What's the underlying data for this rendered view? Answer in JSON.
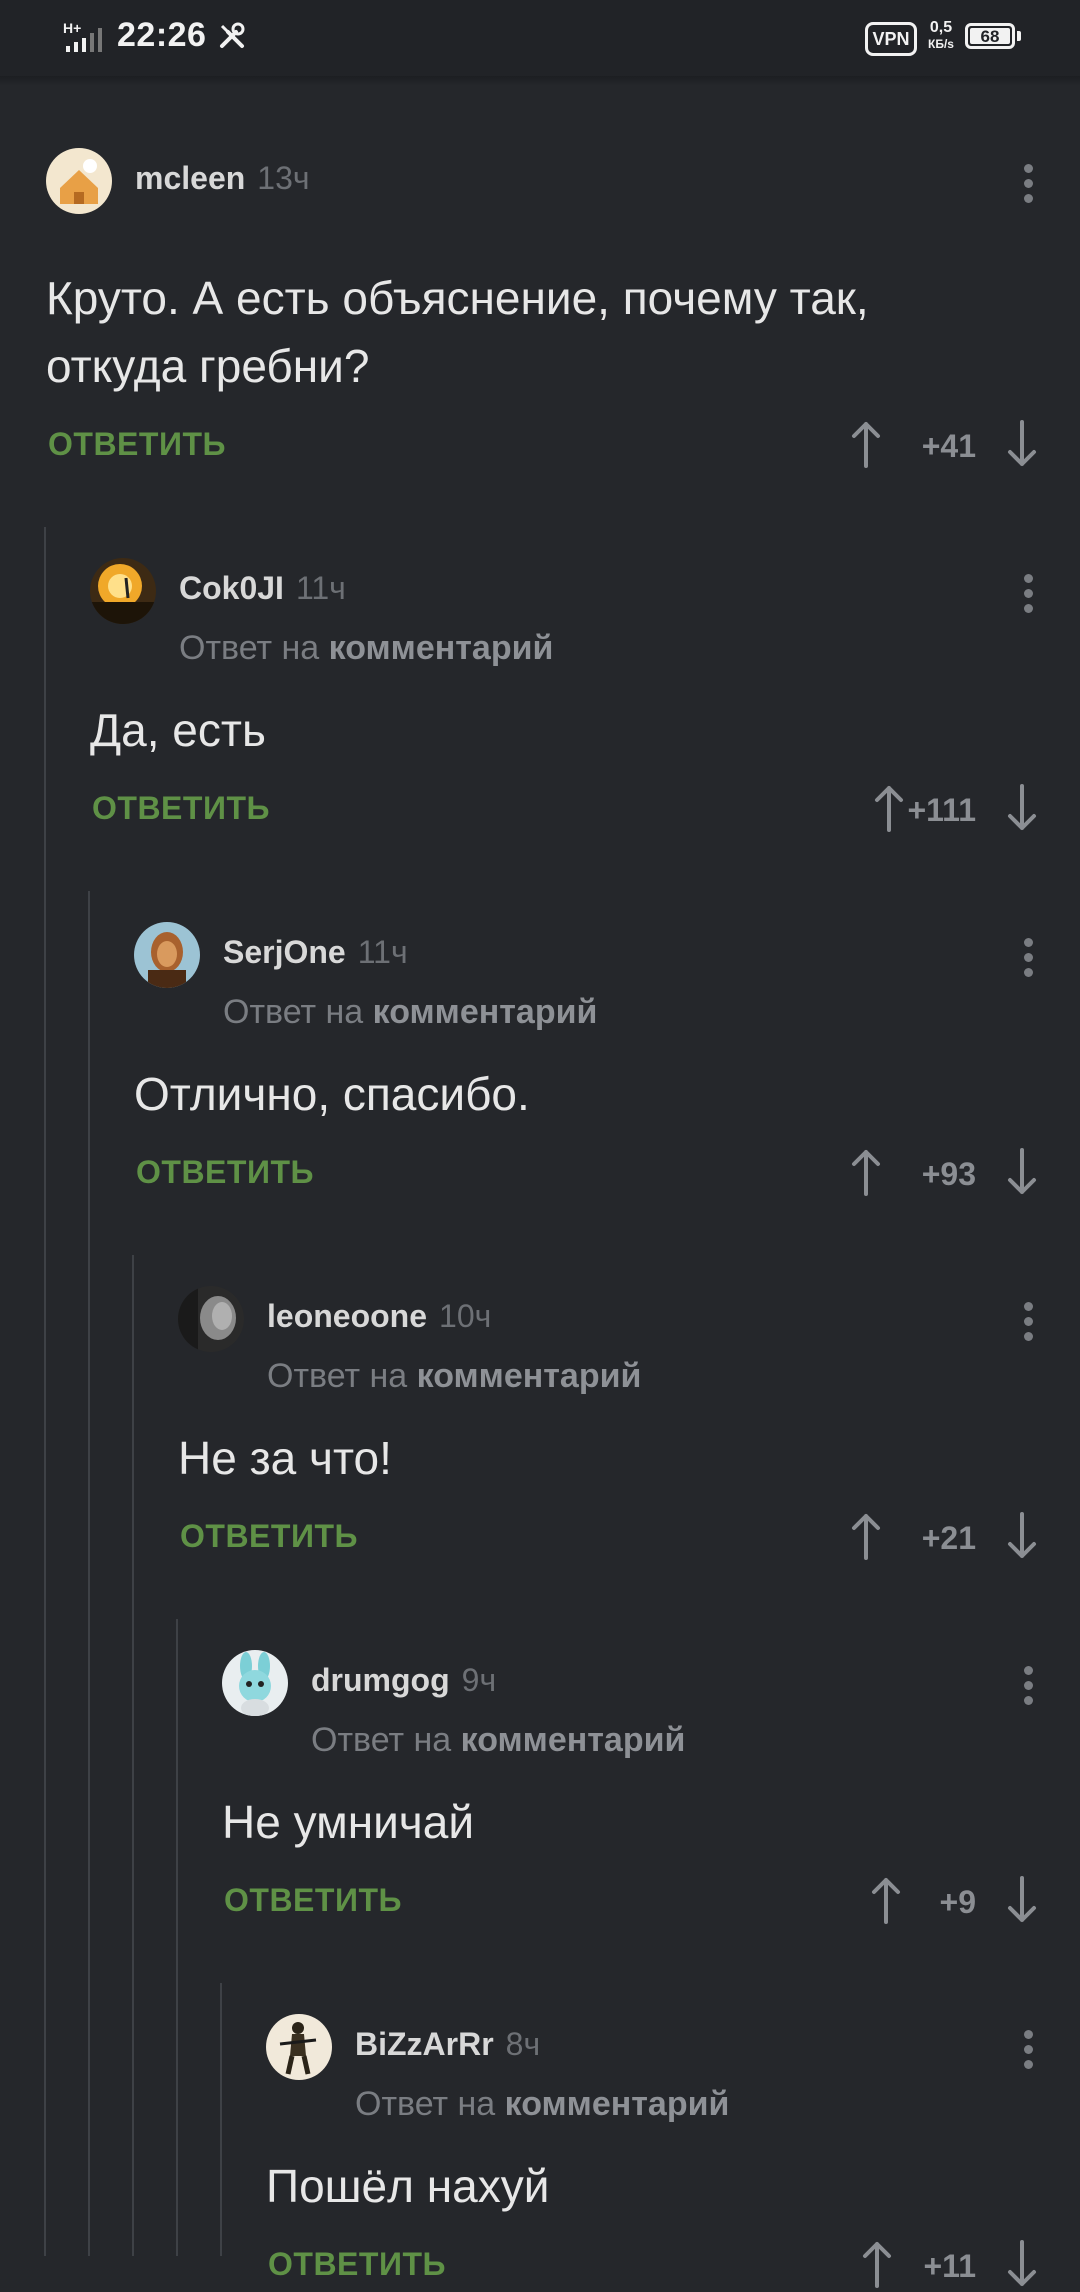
{
  "status_bar": {
    "network": "H+",
    "time": "22:26",
    "vpn": "VPN",
    "speed_value": "0,5",
    "speed_unit": "КБ/s",
    "battery": "68"
  },
  "reply_label": "ОТВЕТИТЬ",
  "reply_to_prefix": "Ответ на",
  "reply_to_target": "комментарий",
  "comments": [
    {
      "author": "mcleen",
      "time": "13ч",
      "text_lines": [
        "Круто. А есть объяснение, почему так,",
        "откуда гребни?"
      ],
      "score": "+41",
      "avatar_icon": "house-avatar-icon"
    },
    {
      "author": "Cok0JI",
      "time": "11ч",
      "text_lines": [
        "Да, есть"
      ],
      "score": "+111",
      "avatar_icon": "sunset-avatar-icon"
    },
    {
      "author": "SerjOne",
      "time": "11ч",
      "text_lines": [
        "Отлично, спасибо."
      ],
      "score": "+93",
      "avatar_icon": "portrait-avatar-icon"
    },
    {
      "author": "leoneoone",
      "time": "10ч",
      "text_lines": [
        "Не за что!"
      ],
      "score": "+21",
      "avatar_icon": "face-avatar-icon"
    },
    {
      "author": "drumgog",
      "time": "9ч",
      "text_lines": [
        "Не умничай"
      ],
      "score": "+9",
      "avatar_icon": "plush-bunny-avatar-icon"
    },
    {
      "author": "BiZzArRr",
      "time": "8ч",
      "text_lines": [
        "Пошёл нахуй"
      ],
      "score": "+11",
      "avatar_icon": "soldier-avatar-icon"
    }
  ],
  "colors": {
    "background": "#25272b",
    "reply_green": "#5f9146",
    "author": "#d8d8d8",
    "muted": "#7a7d82"
  }
}
